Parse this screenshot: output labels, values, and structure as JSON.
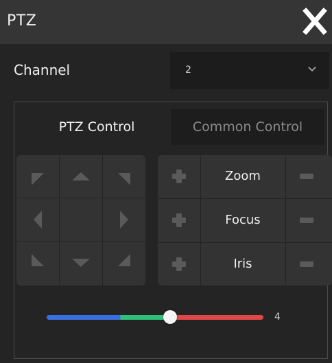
{
  "window": {
    "title": "PTZ"
  },
  "channel": {
    "label": "Channel",
    "value": "2"
  },
  "tabs": [
    {
      "label": "PTZ Control",
      "active": true
    },
    {
      "label": "Common Control",
      "active": false
    }
  ],
  "controls": [
    {
      "label": "Zoom"
    },
    {
      "label": "Focus"
    },
    {
      "label": "Iris"
    }
  ],
  "speed": {
    "value": "4",
    "fraction": 0.57
  },
  "colors": {
    "panel_bg": "#242424",
    "titlebar_bg": "#353535",
    "button_bg": "#333333",
    "icon_gray": "#5a5a5a",
    "slider_blue": "#3a6fe0",
    "slider_green": "#2fc07a",
    "slider_red": "#e04848"
  },
  "icons": [
    "close-icon",
    "chevron-down-icon",
    "arrow-up-left-icon",
    "arrow-up-icon",
    "arrow-up-right-icon",
    "arrow-left-icon",
    "arrow-right-icon",
    "arrow-down-left-icon",
    "arrow-down-icon",
    "arrow-down-right-icon",
    "plus-icon",
    "minus-icon"
  ]
}
